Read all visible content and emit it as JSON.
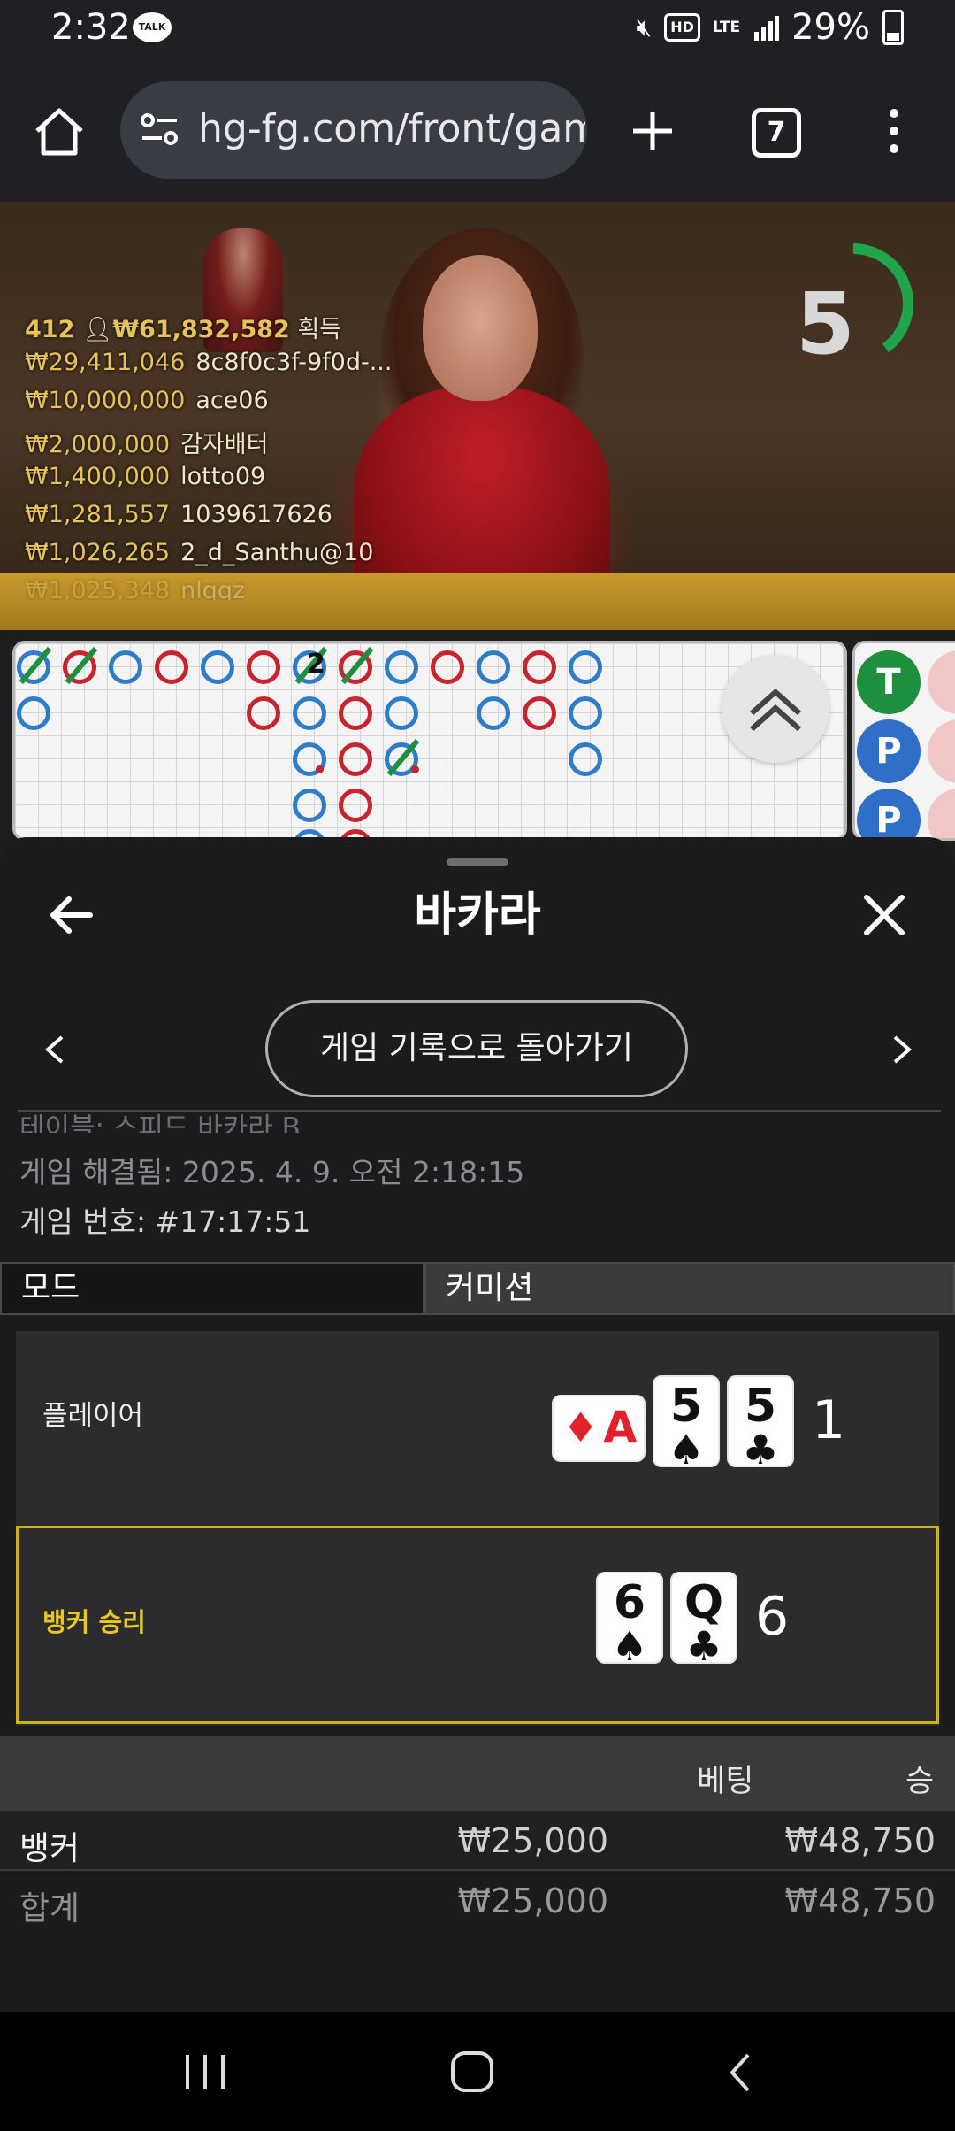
{
  "status_bar": {
    "time": "2:32",
    "talk_badge": "TALK",
    "hd": "HD",
    "network": "LTE",
    "battery": "29%"
  },
  "browser": {
    "url": "hg-fg.com/front/gam",
    "tab_count": "7"
  },
  "video": {
    "timer": "5",
    "timer_progress": 0.4,
    "players_count": "412",
    "total_won": "₩61,832,582",
    "won_label": "획득",
    "winners": [
      {
        "amount": "₩29,411,046",
        "name": "8c8f0c3f-9f0d-..."
      },
      {
        "amount": "₩10,000,000",
        "name": "ace06"
      },
      {
        "amount": "₩2,000,000",
        "name": "감자배터"
      },
      {
        "amount": "₩1,400,000",
        "name": "lotto09"
      },
      {
        "amount": "₩1,281,557",
        "name": "1039617626"
      },
      {
        "amount": "₩1,026,265",
        "name": "2_d_Santhu@10"
      },
      {
        "amount": "₩1,025,348",
        "name": "nlqqz"
      }
    ]
  },
  "roadmap": {
    "marker": "2",
    "predictions": [
      "T",
      "P",
      "P"
    ]
  },
  "sheet": {
    "title": "바카라",
    "history_button": "게임 기록으로 돌아가기",
    "table_line": "테이블: 스피드 바카라 B",
    "resolved": "게임 해결됨: 2025. 4. 9. 오전 2:18:15",
    "game_number": "게임 번호: #17:17:51",
    "tabs": [
      "모드",
      "커미션"
    ],
    "player": {
      "label": "플레이어",
      "cards": [
        {
          "rank": "A",
          "suit": "♦"
        },
        {
          "rank": "5",
          "suit": "♠"
        },
        {
          "rank": "5",
          "suit": "♣"
        }
      ],
      "score": "1"
    },
    "banker": {
      "label": "뱅커 승리",
      "cards": [
        {
          "rank": "6",
          "suit": "♠"
        },
        {
          "rank": "Q",
          "suit": "♣"
        }
      ],
      "score": "6"
    },
    "bets": {
      "bet_header": "베팅",
      "win_header": "승",
      "rows": [
        {
          "name": "뱅커",
          "bet": "₩25,000",
          "win": "₩48,750"
        },
        {
          "name": "합계",
          "bet": "₩25,000",
          "win": "₩48,750"
        }
      ]
    }
  },
  "colors": {
    "banker_highlight": "#c9b21a",
    "timer_ring": "#1fa64a",
    "player_blue": "#2f7dc7",
    "banker_red": "#c8242f"
  }
}
